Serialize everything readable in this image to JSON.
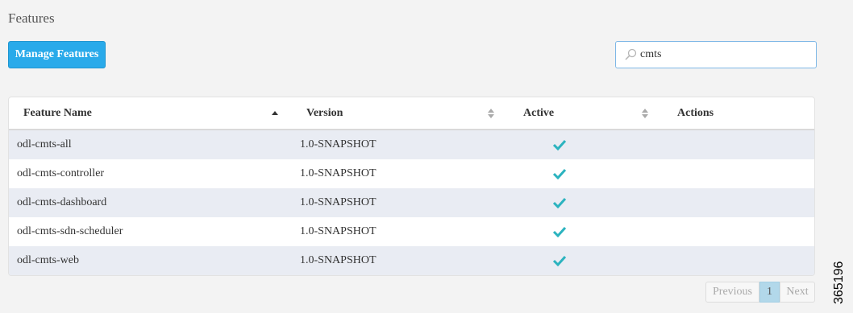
{
  "page": {
    "title": "Features"
  },
  "toolbar": {
    "manage_label": "Manage Features"
  },
  "search": {
    "value": "cmts",
    "icon": "search-icon"
  },
  "table": {
    "columns": [
      {
        "label": "Feature Name",
        "sort": "ascending"
      },
      {
        "label": "Version",
        "sort": "unsorted"
      },
      {
        "label": "Active",
        "sort": "unsorted"
      },
      {
        "label": "Actions",
        "sort": "none"
      }
    ],
    "rows": [
      {
        "name": "odl-cmts-all",
        "version": "1.0-SNAPSHOT",
        "active": true
      },
      {
        "name": "odl-cmts-controller",
        "version": "1.0-SNAPSHOT",
        "active": true
      },
      {
        "name": "odl-cmts-dashboard",
        "version": "1.0-SNAPSHOT",
        "active": true
      },
      {
        "name": "odl-cmts-sdn-scheduler",
        "version": "1.0-SNAPSHOT",
        "active": true
      },
      {
        "name": "odl-cmts-web",
        "version": "1.0-SNAPSHOT",
        "active": true
      }
    ]
  },
  "pagination": {
    "previous": "Previous",
    "current": "1",
    "next": "Next"
  },
  "figure_id": "365196",
  "colors": {
    "accent": "#29aaea",
    "check": "#2bb3bf",
    "row_alt": "#e9ecf3",
    "page_active": "#b2d8ea"
  }
}
